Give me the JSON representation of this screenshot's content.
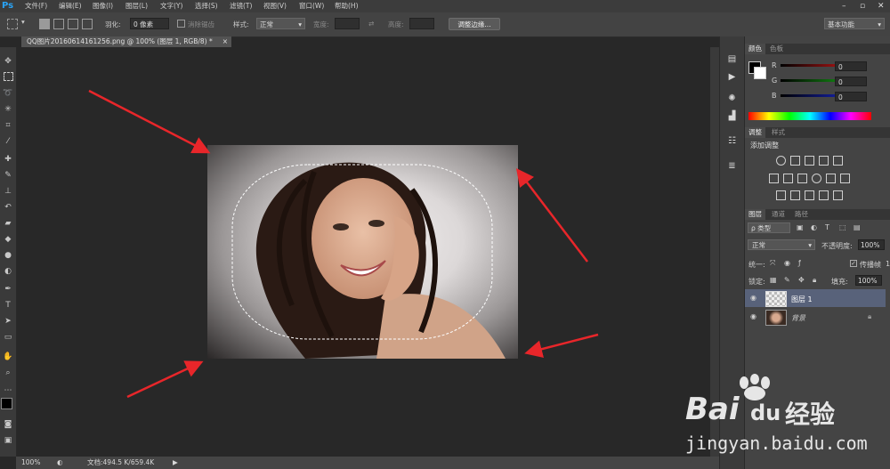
{
  "app": {
    "logo": "Ps"
  },
  "menu": [
    "文件(F)",
    "编辑(E)",
    "图像(I)",
    "图层(L)",
    "文字(Y)",
    "选择(S)",
    "滤镜(T)",
    "视图(V)",
    "窗口(W)",
    "帮助(H)"
  ],
  "options": {
    "feather_label": "羽化:",
    "feather_value": "0 像素",
    "antialias_label": "消除锯齿",
    "style_label": "样式:",
    "style_value": "正常",
    "width_label": "宽度:",
    "height_label": "高度:",
    "refine_edge_button": "调整边缘...",
    "workspace": "基本功能"
  },
  "document": {
    "tab_title": "QQ图片20160614161256.png @ 100% (图层 1, RGB/8) *"
  },
  "status": {
    "zoom": "100%",
    "doc_info": "文档:494.5 K/659.4K"
  },
  "color_panel": {
    "tabs": [
      "颜色",
      "色板"
    ],
    "channels": [
      {
        "label": "R",
        "value": "0",
        "color": "#d11a1a"
      },
      {
        "label": "G",
        "value": "0",
        "color": "#19a319"
      },
      {
        "label": "B",
        "value": "0",
        "color": "#1a2bd1"
      }
    ]
  },
  "adjust_panel": {
    "tabs": [
      "调整",
      "样式"
    ],
    "title": "添加调整"
  },
  "layers_panel": {
    "tabs": [
      "图层",
      "通道",
      "路径"
    ],
    "filter_kind": "类型",
    "blend_mode": "正常",
    "opacity_label": "不透明度:",
    "opacity_value": "100%",
    "unify_label": "统一:",
    "propagate_label": "传播帧",
    "propagate_value": "1",
    "lock_label": "锁定:",
    "fill_label": "填充:",
    "fill_value": "100%",
    "layers": [
      {
        "name": "图层 1",
        "selected": true
      },
      {
        "name": "背景",
        "selected": false
      }
    ]
  },
  "watermark": {
    "brand": "Bai",
    "brand2": "du",
    "brand_cn": "经验",
    "url": "jingyan.baidu.com"
  },
  "colors": {
    "accent": "#2aa3f5",
    "arrow": "#e8262a",
    "selected_layer": "#58627a"
  }
}
